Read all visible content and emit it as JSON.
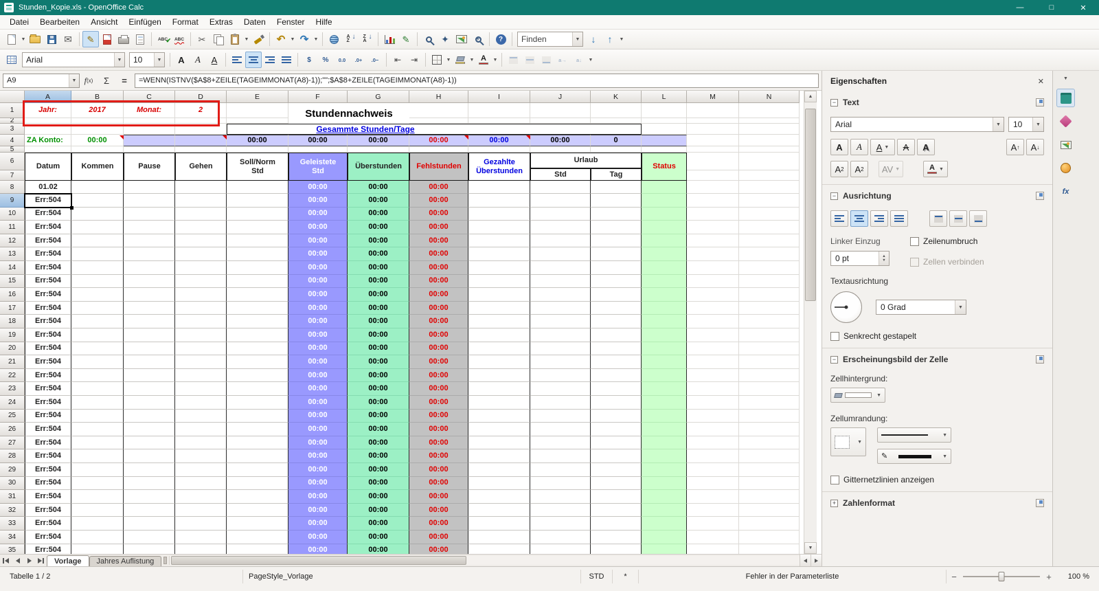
{
  "window": {
    "title": "Stunden_Kopie.xls - OpenOffice Calc",
    "controls": {
      "minimize": "—",
      "maximize": "□",
      "close": "✕"
    }
  },
  "menu": [
    "Datei",
    "Bearbeiten",
    "Ansicht",
    "Einfügen",
    "Format",
    "Extras",
    "Daten",
    "Fenster",
    "Hilfe"
  ],
  "toolbar_main": {
    "find_value": "Finden",
    "icons": [
      "new-document",
      "open",
      "save",
      "email",
      "edit-file",
      "export-pdf",
      "print",
      "page-preview",
      "spellcheck",
      "auto-spellcheck",
      "cut",
      "copy",
      "paste",
      "format-paintbrush",
      "undo",
      "redo",
      "hyperlink",
      "sort-ascending",
      "sort-descending",
      "insert-chart",
      "show-draw-functions",
      "find-and-replace",
      "navigator",
      "gallery",
      "zoom",
      "help",
      "find-next",
      "find-previous"
    ],
    "active_icons": [
      "edit-file"
    ]
  },
  "toolbar_format": {
    "font_name": "Arial",
    "font_size": "10",
    "icons": [
      "format-table",
      "bold",
      "italic",
      "underline",
      "align-left",
      "align-center",
      "align-right",
      "align-justify",
      "number-format-currency",
      "number-format-percent",
      "number-format-standard",
      "add-decimal-place",
      "delete-decimal-place",
      "decrease-indent",
      "increase-indent",
      "borders",
      "background-color",
      "font-color",
      "align-top",
      "center-vertically",
      "align-bottom",
      "text-direction-ltr",
      "text-direction-ttb"
    ],
    "active_icons": [
      "align-center"
    ],
    "disabled_icons": [
      "align-top",
      "center-vertically",
      "align-bottom",
      "text-direction-ltr",
      "text-direction-ttb"
    ]
  },
  "formula_bar": {
    "cell_ref": "A9",
    "formula": "=WENN(ISTNV($A$8+ZEILE(TAGEIMMONAT(A8)-1));\"\";$A$8+ZEILE(TAGEIMMONAT(A8)-1))"
  },
  "spreadsheet": {
    "columns": [
      "A",
      "B",
      "C",
      "D",
      "E",
      "F",
      "G",
      "H",
      "I",
      "J",
      "K",
      "L",
      "M",
      "N"
    ],
    "selected_cell": "A9",
    "selected_column": "A",
    "selected_row": 9,
    "annotation_box": "A1:D1",
    "title_row": {
      "jahr_label": "Jahr:",
      "jahr_value": "2017",
      "monat_label": "Monat:",
      "monat_value": "2",
      "sheet_title": "Stundennachweis"
    },
    "summary_banner": "Gesammte Stunden/Tage",
    "za_row": {
      "label": "ZA Konto:",
      "value": "00:00",
      "cells": [
        {
          "col": "E",
          "text": "00:00",
          "color": "#000000"
        },
        {
          "col": "F",
          "text": "00:00",
          "color": "#000000"
        },
        {
          "col": "G",
          "text": "00:00",
          "color": "#000000"
        },
        {
          "col": "H",
          "text": "00:00",
          "color": "#e00000"
        },
        {
          "col": "I",
          "text": "00:00",
          "color": "#0000e0"
        },
        {
          "col": "J",
          "text": "00:00",
          "color": "#000000"
        },
        {
          "col": "K",
          "text": "0",
          "color": "#000000"
        }
      ],
      "comment_markers": [
        "B4",
        "D4",
        "H4",
        "I4"
      ]
    },
    "table_header": {
      "datum": "Datum",
      "kommen": "Kommen",
      "pause": "Pause",
      "gehen": "Gehen",
      "soll_norm": "Soll/Norm Std",
      "geleistete": "Geleistete Std",
      "ueberstunden": "Überstunden",
      "fehlstunden": "Fehlstunden",
      "gezahlte": "Gezahlte Überstunden",
      "urlaub": "Urlaub",
      "urlaub_std": "Std",
      "urlaub_tag": "Tag",
      "status": "Status"
    },
    "rows": {
      "first_row": 8,
      "last_row": 35,
      "first_date": "01.02",
      "error_text": "Err:504",
      "time_text": "00:00"
    }
  },
  "sidebar": {
    "title": "Eigenschaften",
    "tabs": [
      "properties",
      "styles",
      "gallery",
      "navigator",
      "functions"
    ],
    "active_tab": "properties",
    "text_section": {
      "label": "Text",
      "font_name": "Arial",
      "font_size": "10"
    },
    "alignment_section": {
      "label": "Ausrichtung",
      "indent_label": "Linker Einzug",
      "indent_value": "0 pt",
      "wrap_label": "Zeilenumbruch",
      "merge_label": "Zellen verbinden",
      "orientation_label": "Textausrichtung",
      "degrees_value": "0 Grad",
      "stacked_label": "Senkrecht gestapelt"
    },
    "cell_section": {
      "label": "Erscheinungsbild der Zelle",
      "background_label": "Zellhintergrund:",
      "border_label": "Zellumrandung:",
      "gridlines_label": "Gitternetzlinien anzeigen"
    },
    "number_section": {
      "label": "Zahlenformat"
    }
  },
  "sheet_tabs": [
    {
      "label": "Vorlage",
      "active": true
    },
    {
      "label": "Jahres Auflistung",
      "active": false
    }
  ],
  "status_bar": {
    "sheet_info": "Tabelle 1 / 2",
    "page_style": "PageStyle_Vorlage",
    "mode": "STD",
    "modified": "*",
    "message": "Fehler in der Parameterliste",
    "zoom_level": "100 %"
  }
}
